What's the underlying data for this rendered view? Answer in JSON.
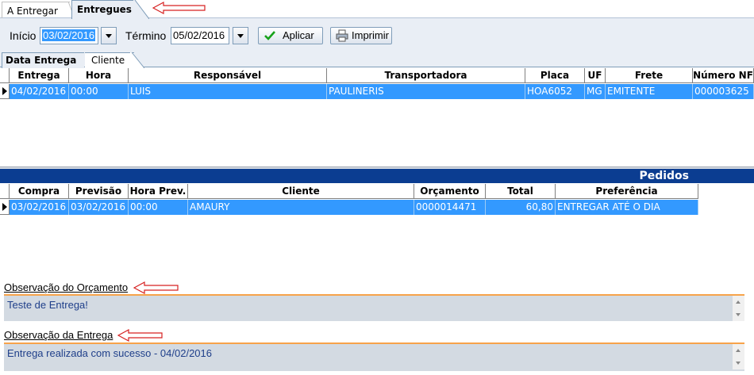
{
  "tabs": {
    "a_entregar": "A Entregar",
    "entregues": "Entregues"
  },
  "filter": {
    "inicio_label": "Início",
    "inicio_value": "03/02/2016",
    "termino_label": "Término",
    "termino_value": "05/02/2016",
    "aplicar_label": "Aplicar",
    "imprimir_label": "Imprimir"
  },
  "inner_tabs": {
    "data_entrega": "Data Entrega",
    "cliente": "Cliente"
  },
  "entregas": {
    "columns": [
      "Entrega",
      "Hora",
      "Responsável",
      "Transportadora",
      "Placa",
      "UF",
      "Frete",
      "Número NF"
    ],
    "rows": [
      [
        "04/02/2016",
        "00:00",
        "LUIS",
        "PAULINERIS",
        "HOA6052",
        "MG",
        "EMITENTE",
        "000003625"
      ]
    ]
  },
  "pedidos": {
    "title": "Pedidos",
    "columns": [
      "Compra",
      "Previsão",
      "Hora Prev.",
      "Cliente",
      "Orçamento",
      "Total",
      "Preferência"
    ],
    "rows": [
      [
        "03/02/2016",
        "03/02/2016",
        "00:00",
        "AMAURY",
        "0000014471",
        "60,80",
        "ENTREGAR ATÉ O DIA"
      ]
    ]
  },
  "obs_orcamento": {
    "label": "Observação do Orçamento",
    "text": "Teste de Entrega!"
  },
  "obs_entrega": {
    "label": "Observação da Entrega",
    "text": "Entrega realizada com sucesso - 04/02/2016"
  },
  "colors": {
    "selection": "#3399ff",
    "pedidos_bar": "#0b3d91",
    "annotation_arrow": "#d62020",
    "obs_accent": "#f7a34a"
  }
}
